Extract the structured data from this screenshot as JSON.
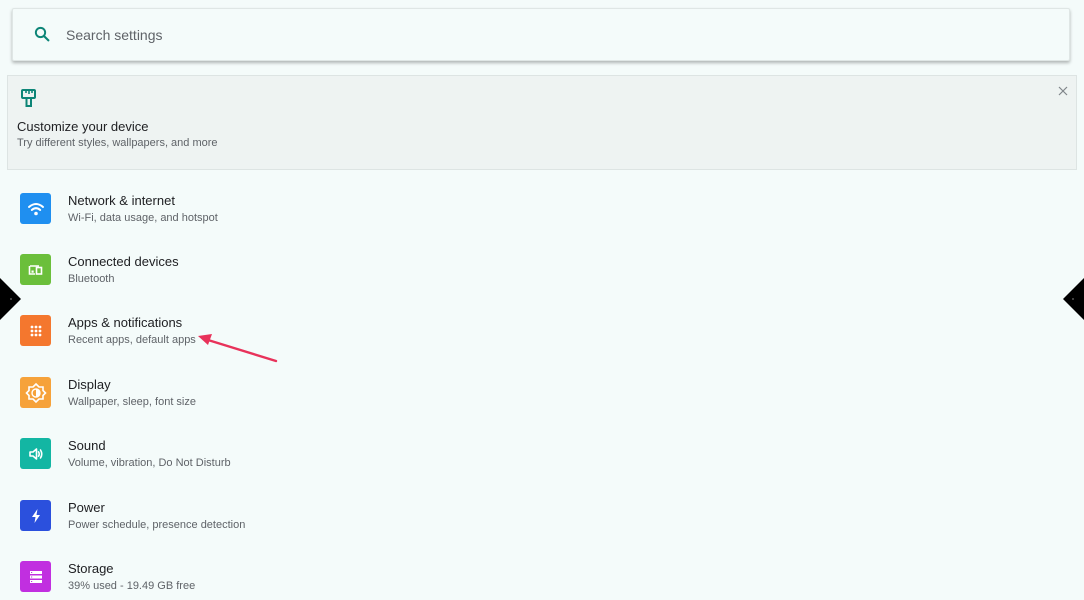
{
  "search": {
    "placeholder": "Search settings",
    "icon": "search-icon"
  },
  "promo": {
    "icon": "paint-brush-icon",
    "title": "Customize your device",
    "subtitle": "Try different styles, wallpapers, and more",
    "close_icon": "close-icon"
  },
  "settings": {
    "items": [
      {
        "id": "network",
        "icon": "wifi-icon",
        "color": "#1f8ff0",
        "title": "Network & internet",
        "summary": "Wi-Fi, data usage, and hotspot"
      },
      {
        "id": "connected-devices",
        "icon": "devices-icon",
        "color": "#6bbf3b",
        "title": "Connected devices",
        "summary": "Bluetooth"
      },
      {
        "id": "apps",
        "icon": "apps-grid-icon",
        "color": "#f4772e",
        "title": "Apps & notifications",
        "summary": "Recent apps, default apps"
      },
      {
        "id": "display",
        "icon": "brightness-icon",
        "color": "#f6a23a",
        "title": "Display",
        "summary": "Wallpaper, sleep, font size"
      },
      {
        "id": "sound",
        "icon": "volume-icon",
        "color": "#13b6a3",
        "title": "Sound",
        "summary": "Volume, vibration, Do Not Disturb"
      },
      {
        "id": "power",
        "icon": "lightning-icon",
        "color": "#2b50dd",
        "title": "Power",
        "summary": "Power schedule, presence detection"
      },
      {
        "id": "storage",
        "icon": "storage-icon",
        "color": "#c12fe0",
        "title": "Storage",
        "summary": "39% used - 19.49 GB free"
      }
    ]
  },
  "colors": {
    "background": "#f4fbfa",
    "accent": "#0d8577",
    "annotation": "#e8325a"
  }
}
